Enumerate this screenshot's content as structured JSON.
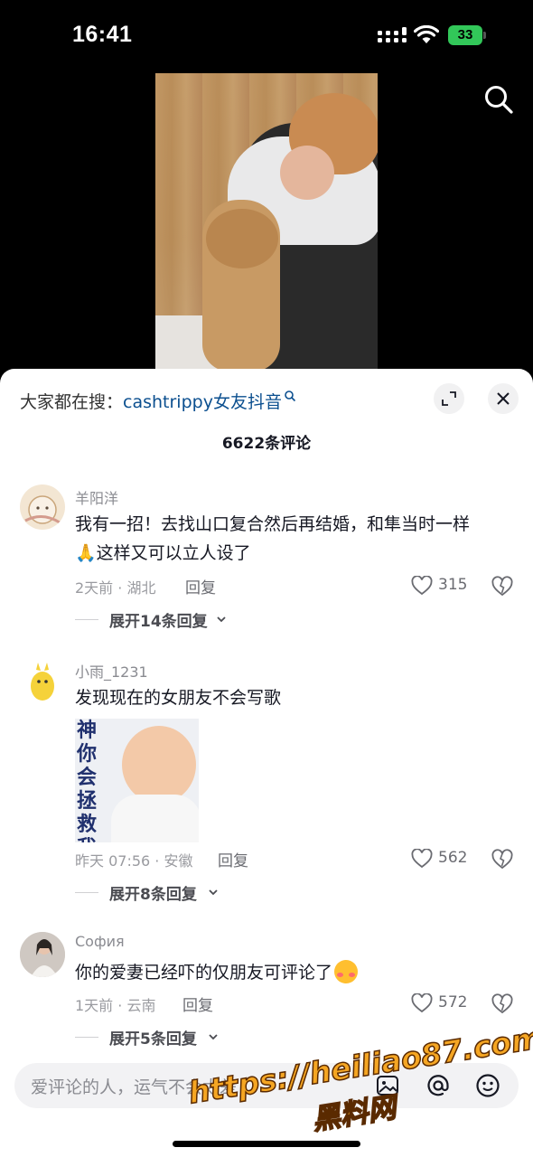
{
  "status_bar": {
    "time": "16:41",
    "battery": "33",
    "icons": [
      "signal-icon",
      "wifi-icon",
      "battery-icon"
    ]
  },
  "top_bar": {
    "search_icon": "search-icon"
  },
  "sheet": {
    "hot_search_prefix": "大家都在搜：",
    "hot_search_keyword": "cashtrippy女友抖音",
    "comment_count": "6622条评论",
    "icons": {
      "expand": "expand-icon",
      "close": "close-icon"
    }
  },
  "comments": [
    {
      "user": "羊阳洋",
      "text_line1": "我有一招！去找山口复合然后再结婚，和隼当时一样",
      "text_line2": "这样又可以立人设了",
      "time_location": "2天前 · 湖北",
      "reply_label": "回复",
      "likes": "315",
      "expand_label": "展开14条回复"
    },
    {
      "user": "小雨_1231",
      "text_line1": "发现现在的女朋友不会写歌",
      "sticker_text": "神你会拯救我吗",
      "time_location": "昨天 07:56 · 安徽",
      "reply_label": "回复",
      "likes": "562",
      "expand_label": "展开8条回复"
    },
    {
      "user": "София",
      "text_line1": "你的爱妻已经吓的仅朋友可评论了",
      "time_location": "1天前 · 云南",
      "reply_label": "回复",
      "likes": "572",
      "expand_label": "展开5条回复"
    }
  ],
  "input_bar": {
    "placeholder": "爱评论的人，运气不会太差",
    "icons": [
      "image-icon",
      "at-icon",
      "emoji-icon"
    ]
  },
  "watermark": {
    "line1": "https://heiliao87.com",
    "line2": "黑料网"
  },
  "colors": {
    "background": "#000000",
    "sheet": "#ffffff",
    "keyword_link": "#0b4f8f",
    "battery_green": "#32c759",
    "watermark": "#f5a623"
  }
}
